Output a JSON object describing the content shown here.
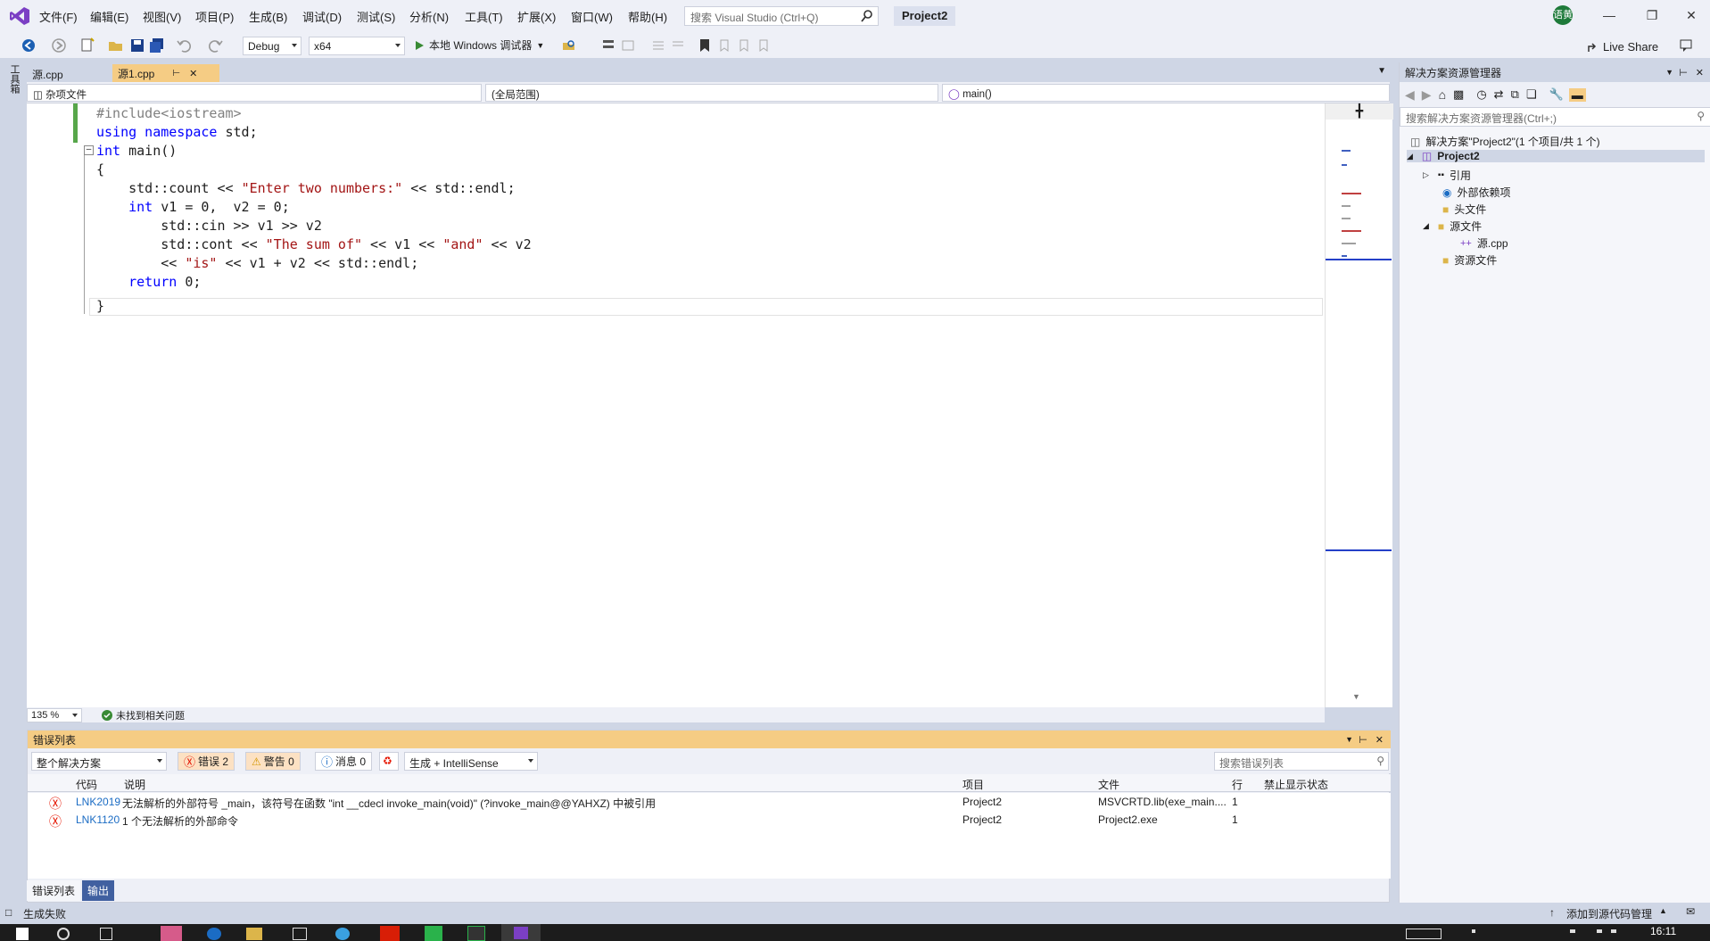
{
  "menu": [
    "文件(F)",
    "编辑(E)",
    "视图(V)",
    "项目(P)",
    "生成(B)",
    "调试(D)",
    "测试(S)",
    "分析(N)",
    "工具(T)",
    "扩展(X)",
    "窗口(W)",
    "帮助(H)"
  ],
  "search": {
    "placeholder": "搜索 Visual Studio (Ctrl+Q)"
  },
  "project_title": "Project2",
  "avatar_text": "语黄",
  "toolbar": {
    "config": "Debug",
    "platform": "x64",
    "run_label": "本地 Windows 调试器",
    "live_share": "Live Share"
  },
  "toolbox_label": "工具箱",
  "tabs": [
    {
      "label": "源.cpp"
    },
    {
      "label": "源1.cpp"
    }
  ],
  "navbar": {
    "scope": "杂项文件",
    "global": "(全局范围)",
    "function": "main()"
  },
  "code_lines": [
    "#include<iostream>",
    "using namespace std;",
    "int main()",
    "{",
    "    std::count << \"Enter two numbers:\" << std::endl;",
    "    int v1 = 0,  v2 = 0;",
    "        std::cin >> v1 >> v2",
    "        std::cont << \"The sum of\" << v1 << \"and\" << v2",
    "        << \"is\" << v1 + v2 << std::endl;",
    "    return 0;",
    "}"
  ],
  "editor_status": {
    "zoom": "135 %",
    "issues": "未找到相关问题"
  },
  "error_list": {
    "title": "错误列表",
    "scope": "整个解决方案",
    "errors_btn": "错误 2",
    "warnings_btn": "警告 0",
    "messages_btn": "消息 0",
    "build_filter": "生成 + IntelliSense",
    "search_placeholder": "搜索错误列表",
    "headers": {
      "code": "代码",
      "desc": "说明",
      "project": "项目",
      "file": "文件",
      "line": "行",
      "suppress": "禁止显示状态"
    },
    "rows": [
      {
        "code": "LNK2019",
        "desc": "无法解析的外部符号 _main，该符号在函数 \"int __cdecl invoke_main(void)\" (?invoke_main@@YAHXZ) 中被引用",
        "project": "Project2",
        "file": "MSVCRTD.lib(exe_main....",
        "line": "1"
      },
      {
        "code": "LNK1120",
        "desc": "1 个无法解析的外部命令",
        "project": "Project2",
        "file": "Project2.exe",
        "line": "1"
      }
    ]
  },
  "bottom_tabs": [
    "错误列表",
    "输出"
  ],
  "solution_explorer": {
    "title": "解决方案资源管理器",
    "search_placeholder": "搜索解决方案资源管理器(Ctrl+;)",
    "solution_label": "解决方案\"Project2\"(1 个项目/共 1 个)",
    "project": "Project2",
    "items": [
      "引用",
      "外部依赖项",
      "头文件",
      "源文件",
      "源.cpp",
      "资源文件"
    ]
  },
  "status": {
    "left": "生成失败",
    "right": "添加到源代码管理"
  },
  "clock": "16:11",
  "colors": {
    "accent": "#f5cc84",
    "error": "#e51400",
    "keyword": "#0000ff",
    "string": "#a31515",
    "chrome": "#cfd6e5"
  }
}
